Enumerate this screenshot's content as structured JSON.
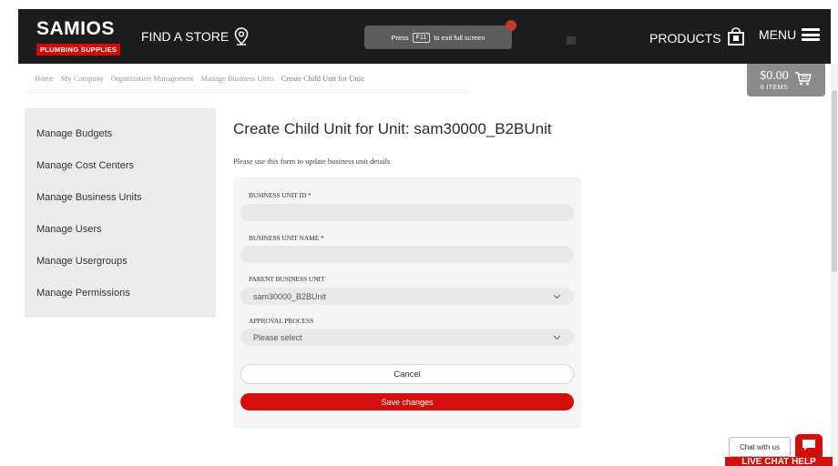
{
  "header": {
    "logo_top": "SAMIOS",
    "logo_sub": "PLUMBING SUPPLIES",
    "find_store": "FIND A STORE",
    "fullscreen_press": "Press",
    "fullscreen_key": "F11",
    "fullscreen_hint": "to exit full screen",
    "products": "PRODUCTS",
    "menu": "MENU"
  },
  "cart": {
    "amount": "$0.00",
    "items": "0 ITEMS"
  },
  "breadcrumb": [
    "Home",
    "My Company",
    "Organization Management",
    "Manage Business Units",
    "Create Child Unit for Unit:"
  ],
  "sidebar": {
    "items": [
      "Manage Budgets",
      "Manage Cost Centers",
      "Manage Business Units",
      "Manage Users",
      "Manage Usergroups",
      "Manage Permissions"
    ]
  },
  "main": {
    "title": "Create Child Unit for Unit: sam30000_B2BUnit",
    "subtitle": "Please use this form to update business unit details"
  },
  "form": {
    "business_unit_id_label": "BUSINESS UNIT ID *",
    "business_unit_id_value": "",
    "business_unit_name_label": "BUSINESS UNIT NAME *",
    "business_unit_name_value": "",
    "parent_unit_label": "PARENT BUSINESS UNIT",
    "parent_unit_value": "sam30000_B2BUnit",
    "approval_label": "APPROVAL PROCESS",
    "approval_value": "Please select",
    "cancel": "Cancel",
    "save": "Save changes"
  },
  "chat": {
    "bubble": "Chat with us",
    "live": "LIVE CHAT HELP"
  },
  "colors": {
    "brand_red": "#d40d0d",
    "header_bg": "#1c1c1c",
    "sidebar_bg": "#ececec",
    "cart_bg": "#8b8b8b"
  },
  "icons": {
    "find_store": "map-pin-icon",
    "products": "shopping-bag-icon",
    "menu": "hamburger-icon",
    "cart": "cart-icon",
    "select_arrow": "chevron-down-icon",
    "chat": "chat-icon"
  }
}
